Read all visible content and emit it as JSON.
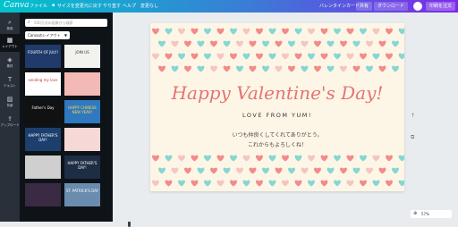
{
  "app": {
    "logo": "Canva"
  },
  "topbar": {
    "menu": [
      "ファイル",
      "サイズを変更",
      "元に戻す",
      "やり直す",
      "ヘルプ",
      "変更なし"
    ],
    "doc_title": "バレンタインカード",
    "share": "共有",
    "download": "ダウンロード",
    "print": "印刷を注文"
  },
  "rail": [
    {
      "icon": "search-icon",
      "label": "検索",
      "glyph": "⌕"
    },
    {
      "icon": "layout-icon",
      "label": "レイアウト",
      "glyph": "▦"
    },
    {
      "icon": "elements-icon",
      "label": "素材",
      "glyph": "◈"
    },
    {
      "icon": "text-icon",
      "label": "テキスト",
      "glyph": "T"
    },
    {
      "icon": "background-icon",
      "label": "背景",
      "glyph": "▨"
    },
    {
      "icon": "upload-icon",
      "label": "アップロード",
      "glyph": "⇪"
    }
  ],
  "panel": {
    "search_placeholder": "500万点の画像から検索",
    "dropdown": "Canvaのレイアウト",
    "thumbnails": [
      {
        "text": "FOURTH OF JULY!",
        "bg": "#1f3a6b",
        "fg": "#ffffff"
      },
      {
        "text": "JOIN US",
        "bg": "#f2f2ee",
        "fg": "#333333"
      },
      {
        "text": "sending my love",
        "bg": "#ffffff",
        "fg": "#c0392b"
      },
      {
        "text": "",
        "bg": "#f3b9b4",
        "fg": "#ffffff"
      },
      {
        "text": "Father's Day",
        "bg": "#111111",
        "fg": "#ffffff"
      },
      {
        "text": "HAPPY CHINESE NEW YEAR!",
        "bg": "#2e79c0",
        "fg": "#ffd54f"
      },
      {
        "text": "HAPPY FATHER'S DAY!",
        "bg": "#1c3f6e",
        "fg": "#ffffff"
      },
      {
        "text": "",
        "bg": "#f6d9d7",
        "fg": "#333333"
      },
      {
        "text": "",
        "bg": "#cfcfcf",
        "fg": "#333333"
      },
      {
        "text": "HAPPY FATHER'S DAY!",
        "bg": "#1d2d44",
        "fg": "#ffffff"
      },
      {
        "text": "",
        "bg": "#3a2a44",
        "fg": "#ffffff"
      },
      {
        "text": "ST. PATRICK'S DAY",
        "bg": "#6a8caf",
        "fg": "#ffffff"
      }
    ]
  },
  "card": {
    "title": "Happy Valentine's Day!",
    "subtitle": "LOVE FROM YUM!",
    "message_line1": "いつも仲良くしてくれてありがとう。",
    "message_line2": "これからもよろしくね！",
    "heart_colors": [
      "#f28b8b",
      "#86d7d2",
      "#f4c6bf",
      "#f28b8b",
      "#86d7d2"
    ]
  },
  "zoom": {
    "label": "57%"
  }
}
